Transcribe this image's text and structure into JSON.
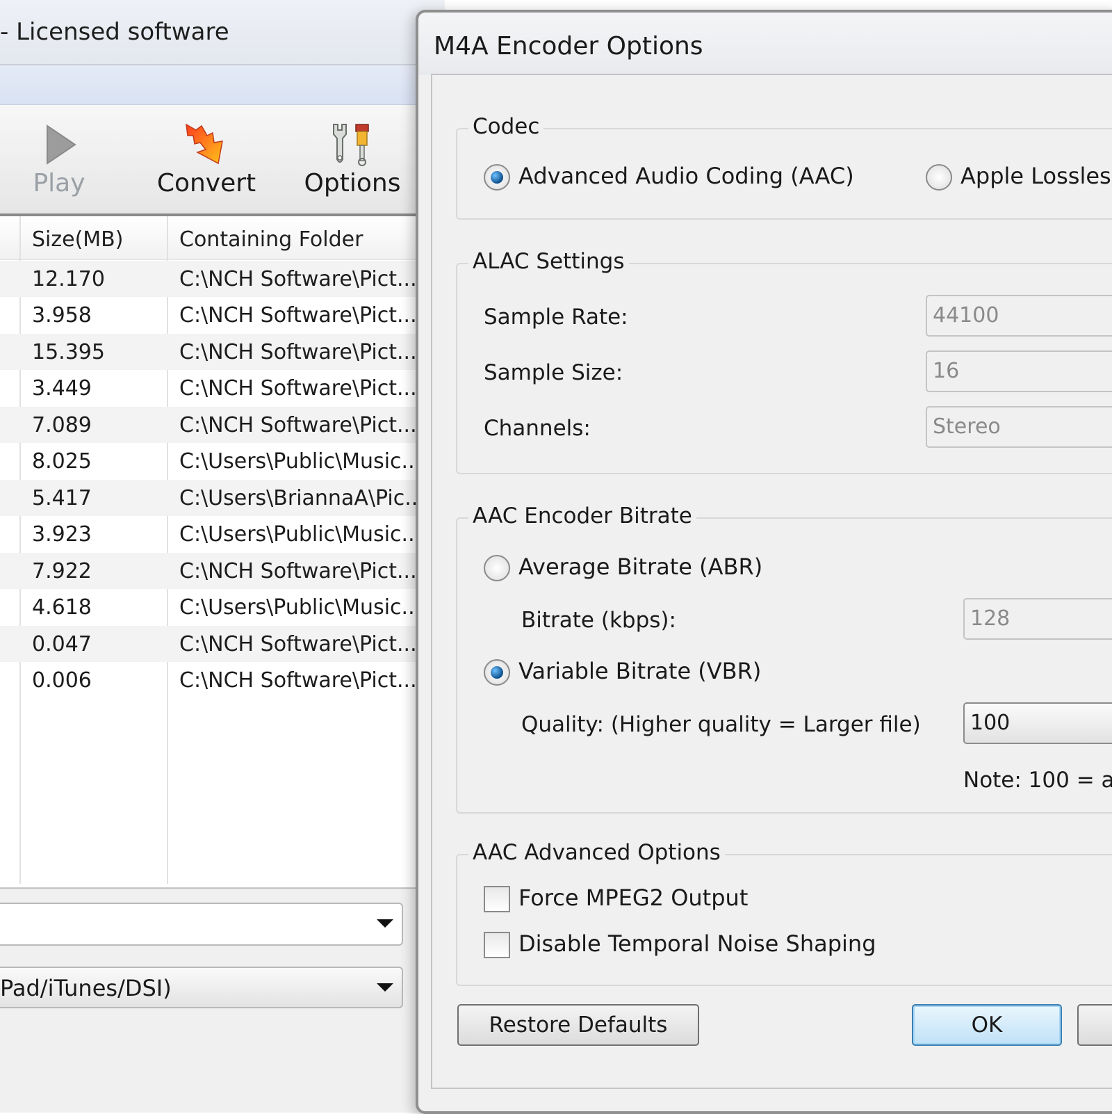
{
  "main_window": {
    "title": "- Licensed software",
    "toolbar": {
      "play_label": "Play",
      "convert_label": "Convert",
      "options_label": "Options"
    },
    "file_list": {
      "columns": {
        "size": "Size(MB)",
        "folder": "Containing Folder"
      },
      "rows": [
        {
          "size": "12.170",
          "folder": "C:\\NCH Software\\Pict..."
        },
        {
          "size": "3.958",
          "folder": "C:\\NCH Software\\Pict..."
        },
        {
          "size": "15.395",
          "folder": "C:\\NCH Software\\Pict..."
        },
        {
          "size": "3.449",
          "folder": "C:\\NCH Software\\Pict..."
        },
        {
          "size": "7.089",
          "folder": "C:\\NCH Software\\Pict..."
        },
        {
          "size": "8.025",
          "folder": "C:\\Users\\Public\\Music..."
        },
        {
          "size": "5.417",
          "folder": "C:\\Users\\BriannaA\\Pic..."
        },
        {
          "size": "3.923",
          "folder": "C:\\Users\\Public\\Music..."
        },
        {
          "size": "7.922",
          "folder": "C:\\NCH Software\\Pict..."
        },
        {
          "size": "4.618",
          "folder": "C:\\Users\\Public\\Music..."
        },
        {
          "size": "0.047",
          "folder": "C:\\NCH Software\\Pict..."
        },
        {
          "size": "0.006",
          "folder": "C:\\NCH Software\\Pict..."
        }
      ]
    },
    "output_folder_value": "",
    "output_format_value": "Pad/iTunes/DSI)"
  },
  "dialog": {
    "title": "M4A Encoder Options",
    "codec": {
      "group_title": "Codec",
      "aac_label": "Advanced Audio Coding (AAC)",
      "alac_label": "Apple Lossles",
      "selected": "aac"
    },
    "alac_settings": {
      "group_title": "ALAC Settings",
      "sample_rate_label": "Sample Rate:",
      "sample_rate_value": "44100",
      "sample_size_label": "Sample Size:",
      "sample_size_value": "16",
      "channels_label": "Channels:",
      "channels_value": "Stereo"
    },
    "bitrate": {
      "group_title": "AAC Encoder Bitrate",
      "abr_label": "Average Bitrate (ABR)",
      "bitrate_label": "Bitrate (kbps):",
      "bitrate_value": "128",
      "vbr_label": "Variable Bitrate (VBR)",
      "quality_label": "Quality: (Higher quality = Larger file)",
      "quality_value": "100",
      "note": "Note: 100 = a",
      "selected": "vbr"
    },
    "advanced": {
      "group_title": "AAC Advanced Options",
      "force_mpeg2_label": "Force MPEG2 Output",
      "force_mpeg2_checked": false,
      "disable_tns_label": "Disable Temporal Noise Shaping",
      "disable_tns_checked": false
    },
    "buttons": {
      "restore_defaults": "Restore Defaults",
      "ok": "OK",
      "cancel": ""
    }
  },
  "icons": {
    "play": "play-icon",
    "convert": "convert-arrow-icon",
    "options": "options-tools-icon",
    "dropdown": "chevron-down-icon"
  },
  "colors": {
    "toolbar_play_disabled": "#9aa0a6",
    "radio_selected": "#0b4f8c",
    "ok_button_accent": "#3c7fb1"
  }
}
